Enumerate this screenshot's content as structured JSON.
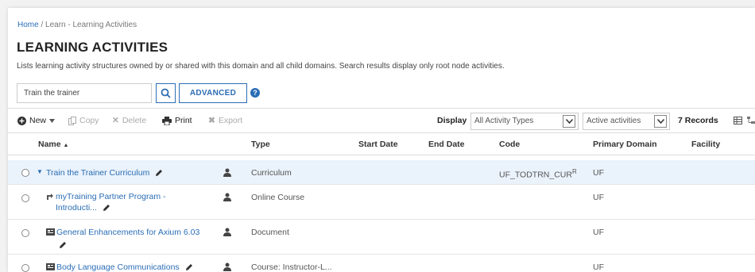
{
  "breadcrumb": {
    "home": "Home",
    "sep": "/",
    "current": "Learn - Learning Activities"
  },
  "page": {
    "title": "LEARNING ACTIVITIES",
    "description": "Lists learning activity structures owned by or shared with this domain and all child domains. Search results display only root node activities."
  },
  "search": {
    "value": "Train the trainer",
    "advanced_label": "ADVANCED",
    "help": "?"
  },
  "toolbar": {
    "new": "New",
    "copy": "Copy",
    "delete": "Delete",
    "print": "Print",
    "export": "Export",
    "display_label": "Display",
    "type_filter": "All Activity Types",
    "status_filter": "Active activities",
    "records": "7 Records"
  },
  "columns": {
    "name": "Name",
    "type": "Type",
    "start": "Start Date",
    "end": "End Date",
    "code": "Code",
    "domain": "Primary Domain",
    "facility": "Facility"
  },
  "rows": [
    {
      "name": "Train the Trainer Curriculum",
      "type": "Curriculum",
      "code": "UF_TODTRN_CUR",
      "code_suffix": "R",
      "domain": "UF"
    },
    {
      "name_line1": "myTraining Partner Program -",
      "name_line2": "Introducti...",
      "type": "Online Course",
      "domain": "UF"
    },
    {
      "name": "General Enhancements for Axium 6.03",
      "type": "Document",
      "domain": "UF"
    },
    {
      "name": "Body Language Communications",
      "type": "Course: Instructor-L...",
      "domain": "UF"
    }
  ],
  "icons": {
    "new": "plus-circle-icon",
    "copy": "copy-icon",
    "delete": "x-icon",
    "print": "printer-icon",
    "export": "export-icon",
    "search": "search-icon",
    "edit": "pencil-icon",
    "owner": "person-icon",
    "doc": "document-icon"
  },
  "colors": {
    "link": "#2a6db5",
    "selected_row": "#eaf2fb"
  }
}
